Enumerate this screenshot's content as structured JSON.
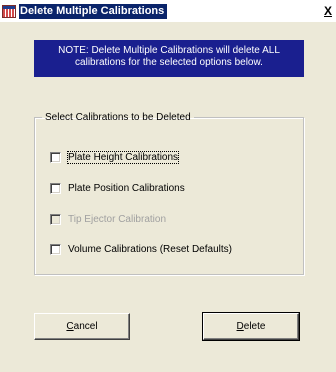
{
  "window": {
    "title": "Delete Multiple Calibrations",
    "close_label": "X"
  },
  "note": {
    "line1": "NOTE:  Delete Multiple Calibrations will delete ALL",
    "line2": "calibrations for the selected options below."
  },
  "group": {
    "legend": "Select Calibrations to be Deleted",
    "options": [
      {
        "label": "Plate Height Calibrations",
        "checked": false,
        "enabled": true,
        "focused": true
      },
      {
        "label": "Plate Position Calibrations",
        "checked": false,
        "enabled": true
      },
      {
        "label": "Tip Ejector Calibration",
        "checked": false,
        "enabled": false
      },
      {
        "label": "Volume Calibrations (Reset Defaults)",
        "checked": false,
        "enabled": true
      }
    ]
  },
  "buttons": {
    "cancel": {
      "mnemonic": "C",
      "rest": "ancel"
    },
    "delete": {
      "mnemonic": "D",
      "rest": "elete"
    }
  },
  "colors": {
    "note_background": "#1a1f8f",
    "titlebar_highlight": "#0a246a",
    "dialog_background": "#ece9d8"
  }
}
